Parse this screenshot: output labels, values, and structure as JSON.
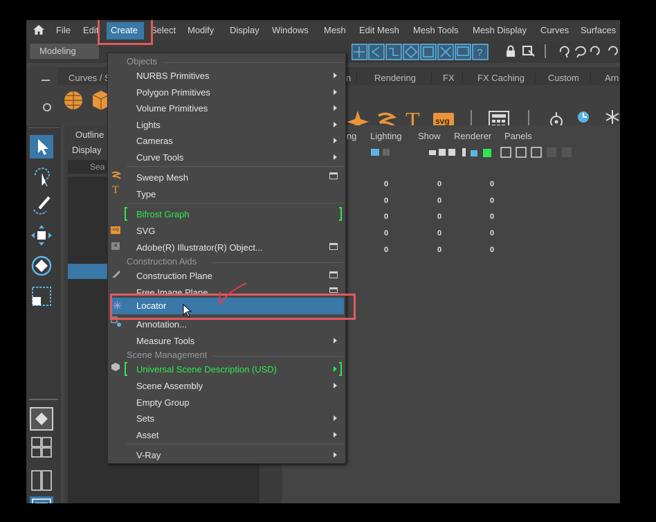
{
  "menubar": {
    "items": [
      "File",
      "Edit",
      "Create",
      "Select",
      "Modify",
      "Display",
      "Windows",
      "Mesh",
      "Edit Mesh",
      "Mesh Tools",
      "Mesh Display",
      "Curves",
      "Surfaces"
    ]
  },
  "statusline": {
    "mode": "Modeling"
  },
  "shelf": {
    "tabs": [
      "Curves / S",
      "n",
      "Rendering",
      "FX",
      "FX Caching",
      "Custom",
      "Arn"
    ],
    "svg_label": "svg",
    "text_tool": "T"
  },
  "outliner": {
    "title": "Outline",
    "display_menu": "Display",
    "search_placeholder": "Sea"
  },
  "viewport": {
    "menus": [
      "ing",
      "Lighting",
      "Show",
      "Renderer",
      "Panels"
    ],
    "zeros": [
      "0",
      "0",
      "0",
      "0",
      "0",
      "0",
      "0",
      "0",
      "0",
      "0",
      "0",
      "0",
      "0",
      "0",
      "0"
    ]
  },
  "create_menu": {
    "section_objects": "Objects",
    "nurbs": "NURBS Primitives",
    "polygon": "Polygon Primitives",
    "volume": "Volume Primitives",
    "lights": "Lights",
    "cameras": "Cameras",
    "curve_tools": "Curve Tools",
    "sweep_mesh": "Sweep Mesh",
    "type": "Type",
    "bifrost": "Bifrost Graph",
    "svg": "SVG",
    "illustrator": "Adobe(R) Illustrator(R) Object...",
    "section_construction": "Construction Aids",
    "construction_plane": "Construction Plane",
    "free_image_plane": "Free Image Plane",
    "locator": "Locator",
    "annotation": "Annotation...",
    "measure_tools": "Measure Tools",
    "section_scene": "Scene Management",
    "usd": "Universal Scene Description (USD)",
    "scene_assembly": "Scene Assembly",
    "empty_group": "Empty Group",
    "sets": "Sets",
    "asset": "Asset",
    "vray": "V-Ray"
  },
  "colors": {
    "highlight": "#3a78a8",
    "annotation_red": "#e05a60",
    "green_plugin": "#2ee84f",
    "icon_orange": "#e8953a"
  }
}
